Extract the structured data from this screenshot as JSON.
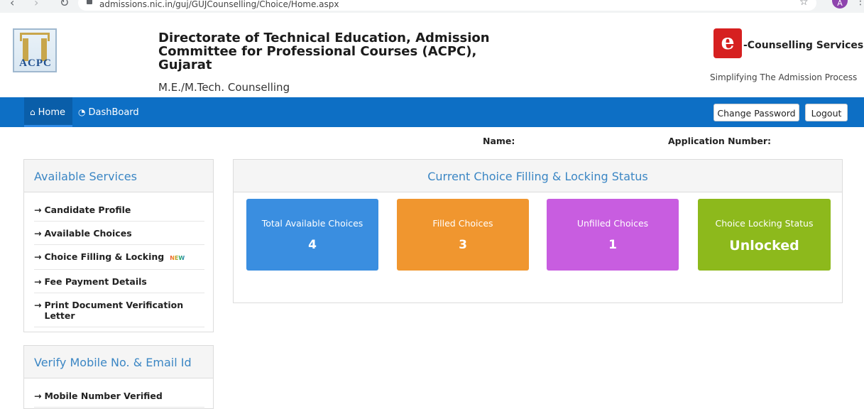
{
  "browser": {
    "url": "admissions.nic.in/guj/GUJCounselling/Choice/Home.aspx",
    "profile_initial": "A"
  },
  "header": {
    "logo_text": "ACPC",
    "org_title": "Directorate of Technical Education, Admission Committee for Professional Courses (ACPC), Gujarat",
    "subtitle": "M.E./M.Tech. Counselling",
    "ec_badge": "e",
    "ec_label": "-Counselling Services",
    "ec_tagline": "Simplifying The Admission Process"
  },
  "navbar": {
    "home": "Home",
    "dashboard": "DashBoard",
    "change_password": "Change Password",
    "logout": "Logout",
    "bg_color": "#0d6fc5"
  },
  "info": {
    "name_label": "Name:",
    "application_label": "Application Number:"
  },
  "services": {
    "title": "Available Services",
    "items": [
      {
        "label": "Candidate Profile"
      },
      {
        "label": "Available Choices"
      },
      {
        "label": "Choice Filling & Locking",
        "badge": "NEW"
      },
      {
        "label": "Fee Payment Details"
      },
      {
        "label": "Print Document Verification Letter"
      }
    ]
  },
  "verify": {
    "title": "Verify Mobile No. & Email Id",
    "items": [
      {
        "label": "Mobile Number Verified"
      }
    ]
  },
  "status": {
    "title": "Current Choice Filling & Locking Status",
    "cards": [
      {
        "title": "Total Available Choices",
        "value": "4",
        "color": "#3a8ee0"
      },
      {
        "title": "Filled Choices",
        "value": "3",
        "color": "#f0962f"
      },
      {
        "title": "Unfilled Choices",
        "value": "1",
        "color": "#c85de0"
      },
      {
        "title": "Choice Locking Status",
        "value": "Unlocked",
        "color": "#8db91c"
      }
    ]
  }
}
